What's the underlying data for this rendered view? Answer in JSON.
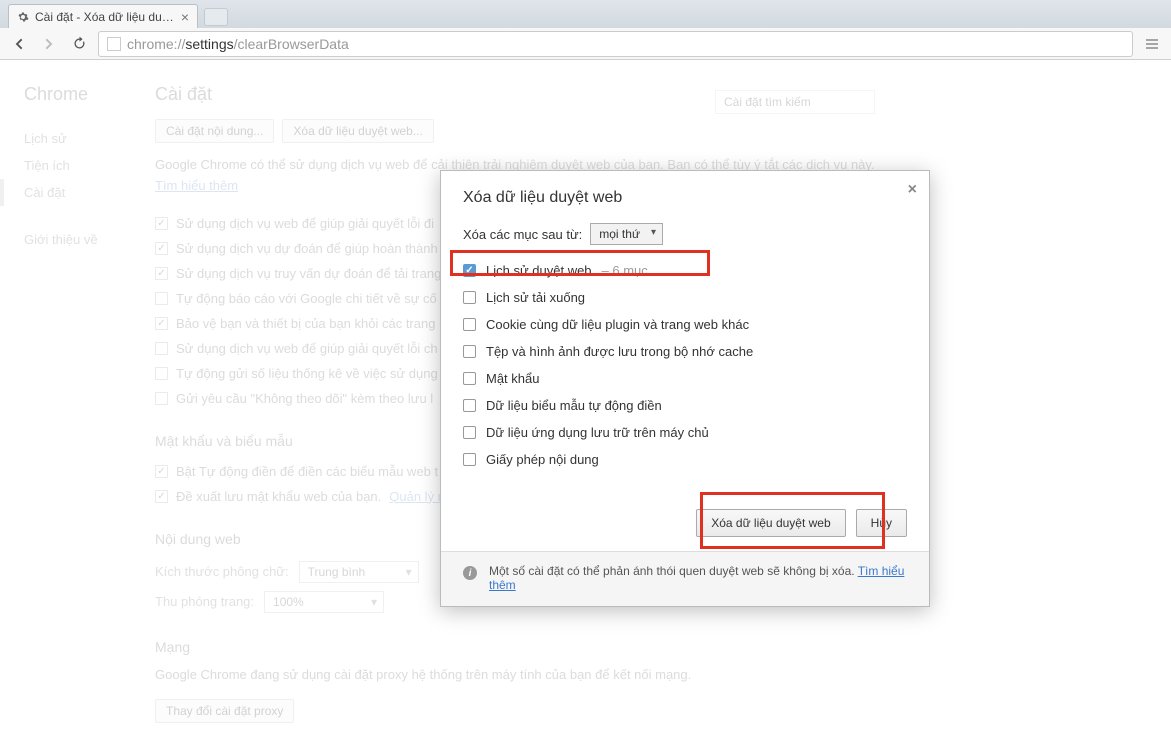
{
  "tab": {
    "title": "Cài đặt - Xóa dữ liệu duyệt v"
  },
  "url": {
    "scheme": "chrome://",
    "host": "settings",
    "path": "/clearBrowserData"
  },
  "sidebar": {
    "brand": "Chrome",
    "items": [
      "Lịch sử",
      "Tiện ích",
      "Cài đặt"
    ],
    "about": "Giới thiệu về"
  },
  "settings": {
    "title": "Cài đặt",
    "search_placeholder": "Cài đặt tìm kiếm",
    "btn_content": "Cài đặt nội dung...",
    "btn_clear": "Xóa dữ liệu duyệt web...",
    "desc_pre": "Google Chrome có thể sử dụng dịch vụ web để cải thiện trải nghiệm duyệt web của bạn. Bạn có thể tùy ý tắt các dịch vụ này. ",
    "learn_more": "Tìm hiểu thêm",
    "privacy_checks": [
      {
        "checked": true,
        "label": "Sử dụng dịch vụ web để giúp giải quyết lỗi đi"
      },
      {
        "checked": true,
        "label": "Sử dụng dịch vụ dự đoán để giúp hoàn thành"
      },
      {
        "checked": true,
        "label": "Sử dụng dịch vụ truy vấn dự đoán để tải trang"
      },
      {
        "checked": false,
        "label": "Tự động báo cáo với Google chi tiết về sự cố"
      },
      {
        "checked": true,
        "label": "Bảo vệ bạn và thiết bị của bạn khỏi các trang"
      },
      {
        "checked": false,
        "label": "Sử dụng dịch vụ web để giúp giải quyết lỗi ch"
      },
      {
        "checked": false,
        "label": "Tự động gửi số liệu thống kê về việc sử dụng"
      },
      {
        "checked": false,
        "label": "Gửi yêu cầu \"Không theo dõi\" kèm theo lưu l"
      }
    ],
    "section_passwords": "Mật khẩu và biểu mẫu",
    "pw_checks": [
      {
        "checked": true,
        "label": "Bật Tự động điền để điền các biểu mẫu web t"
      },
      {
        "checked": true,
        "label": "Đề xuất lưu mật khẩu web của bạn.",
        "link": "Quản lý n"
      }
    ],
    "section_content": "Nội dung web",
    "font_label": "Kích thước phông chữ:",
    "font_value": "Trung bình",
    "zoom_label": "Thu phóng trang:",
    "zoom_value": "100%",
    "section_network": "Mạng",
    "network_desc": "Google Chrome đang sử dụng cài đặt proxy hệ thống trên máy tính của bạn để kết nối mạng.",
    "proxy_btn": "Thay đổi cài đặt proxy"
  },
  "dialog": {
    "title": "Xóa dữ liệu duyệt web",
    "time_label": "Xóa các mục sau từ:",
    "time_value": "mọi thứ",
    "options": [
      {
        "checked": true,
        "label": "Lịch sử duyệt web",
        "sub": "– 6 mục"
      },
      {
        "checked": false,
        "label": "Lịch sử tải xuống"
      },
      {
        "checked": false,
        "label": "Cookie cùng dữ liệu plugin và trang web khác"
      },
      {
        "checked": false,
        "label": "Tệp và hình ảnh được lưu trong bộ nhớ cache"
      },
      {
        "checked": false,
        "label": "Mật khẩu"
      },
      {
        "checked": false,
        "label": "Dữ liệu biểu mẫu tự động điền"
      },
      {
        "checked": false,
        "label": "Dữ liệu ứng dụng lưu trữ trên máy chủ"
      },
      {
        "checked": false,
        "label": "Giấy phép nội dung"
      }
    ],
    "action_clear": "Xóa dữ liệu duyệt web",
    "action_cancel": "Hủy",
    "footer_text": "Một số cài đặt có thể phản ánh thói quen duyệt web sẽ không bị xóa. ",
    "footer_link": "Tìm hiểu thêm"
  }
}
